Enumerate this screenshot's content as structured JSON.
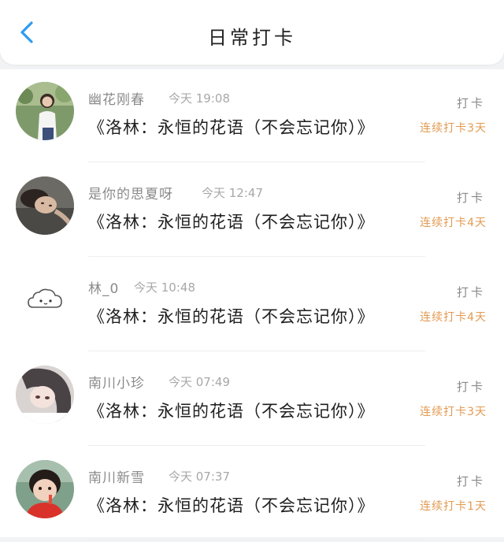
{
  "header": {
    "title": "日常打卡",
    "back_icon": "chevron-left-icon",
    "back_color": "#2f9cf0"
  },
  "checkin_label": "打卡",
  "items": [
    {
      "username": "幽花刚春",
      "time": "今天 19:08",
      "book": "《洛林：永恒的花语（不会忘记你）》",
      "streak": "连续打卡3天",
      "avatar": "avatar-girl-white-shirt"
    },
    {
      "username": "是你的思夏呀",
      "time": "今天 12:47",
      "book": "《洛林：永恒的花语（不会忘记你）》",
      "streak": "连续打卡4天",
      "avatar": "avatar-girl-lying"
    },
    {
      "username": "林_0",
      "time": "今天 10:48",
      "book": "《洛林：永恒的花语（不会忘记你）》",
      "streak": "连续打卡4天",
      "avatar": "avatar-cloud"
    },
    {
      "username": "南川小珍",
      "time": "今天 07:49",
      "book": "《洛林：永恒的花语（不会忘记你）》",
      "streak": "连续打卡3天",
      "avatar": "avatar-anime-girl"
    },
    {
      "username": "南川新雪",
      "time": "今天 07:37",
      "book": "《洛林：永恒的花语（不会忘记你）》",
      "streak": "连续打卡1天",
      "avatar": "avatar-child-red"
    }
  ],
  "colors": {
    "accent": "#2f9cf0",
    "streak": "#e39a52"
  }
}
